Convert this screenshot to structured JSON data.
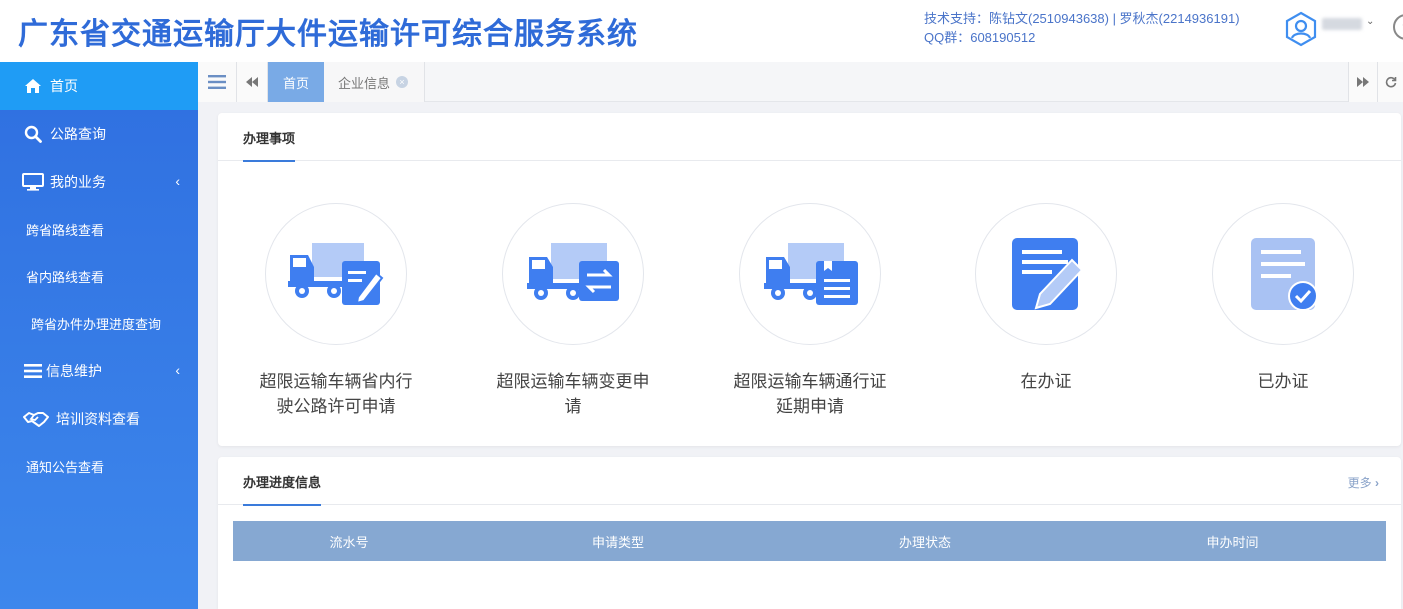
{
  "header": {
    "title": "广东省交通运输厅大件运输许可综合服务系统",
    "support_line": "技术支持：陈钻文(2510943638) | 罗秋杰(2214936191)",
    "qq_line": "QQ群：608190512",
    "user_caret": "⌄"
  },
  "sidebar": {
    "items": [
      {
        "label": "首页",
        "icon": "home-icon"
      },
      {
        "label": "公路查询",
        "icon": "search-icon"
      },
      {
        "label": "我的业务",
        "icon": "monitor-icon"
      },
      {
        "label": "跨省路线查看"
      },
      {
        "label": "省内路线查看"
      },
      {
        "label": "跨省办件办理进度查询"
      },
      {
        "label": "信息维护",
        "icon": "list-icon"
      },
      {
        "label": "培训资料查看",
        "icon": "handshake-icon"
      },
      {
        "label": "通知公告查看"
      }
    ],
    "chevron": "‹"
  },
  "tabs": [
    {
      "label": "首页"
    },
    {
      "label": "企业信息"
    }
  ],
  "todo_panel": {
    "title": "办理事项",
    "services": [
      {
        "label": "超限运输车辆省内行驶公路许可申请",
        "icon": "truck-edit-icon"
      },
      {
        "label": "超限运输车辆变更申请",
        "icon": "truck-swap-icon"
      },
      {
        "label": "超限运输车辆通行证延期申请",
        "icon": "truck-document-icon"
      },
      {
        "label": "在办证",
        "icon": "document-edit-icon"
      },
      {
        "label": "已办证",
        "icon": "document-check-icon"
      }
    ]
  },
  "progress_panel": {
    "title": "办理进度信息",
    "more": "更多",
    "columns": [
      "流水号",
      "申请类型",
      "办理状态",
      "申办时间"
    ]
  },
  "colors": {
    "primary": "#2f6bd8",
    "sidebar_active": "#1f9cf5",
    "tab_active": "#79aae6",
    "table_header": "#86a8d2",
    "icon_blue": "#3f7ef0",
    "icon_light": "#b4cbf7"
  }
}
